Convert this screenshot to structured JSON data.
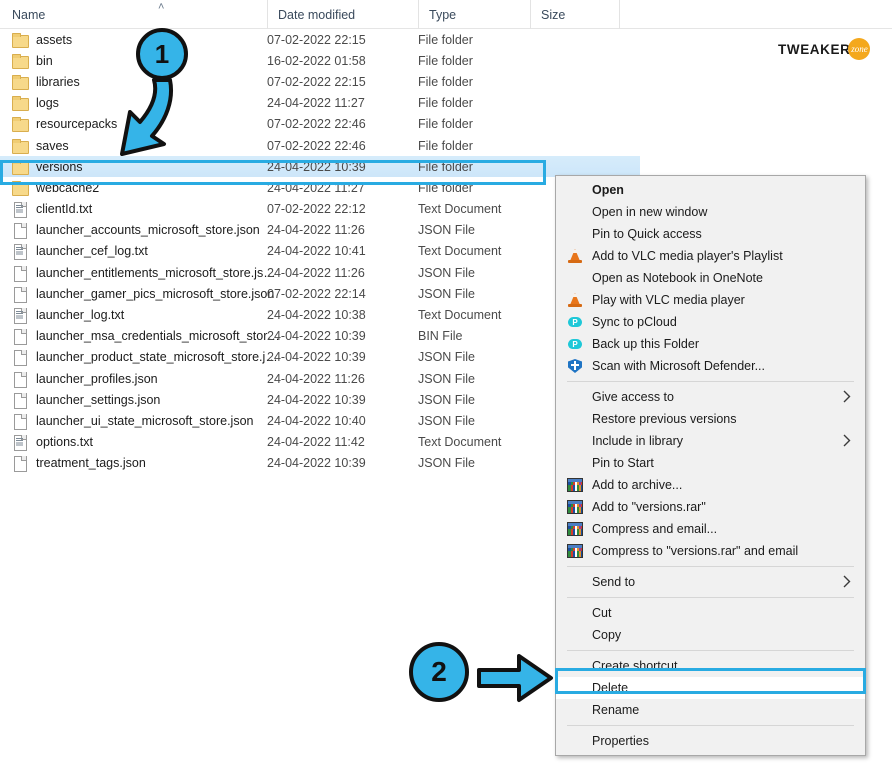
{
  "window": {
    "app": "windows-file-explorer",
    "logo": {
      "text": "TWEAKER",
      "badge": "zone",
      "color": "#F4A81D"
    }
  },
  "columns": [
    {
      "label": "Name",
      "sorted": "ascending",
      "caret": "˄"
    },
    {
      "label": "Date modified"
    },
    {
      "label": "Type"
    },
    {
      "label": "Size"
    }
  ],
  "files": [
    {
      "name": "assets",
      "date": "07-02-2022 22:15",
      "type": "File folder",
      "size": "",
      "icon": "folder",
      "selected": false
    },
    {
      "name": "bin",
      "date": "16-02-2022 01:58",
      "type": "File folder",
      "size": "",
      "icon": "folder",
      "selected": false
    },
    {
      "name": "libraries",
      "date": "07-02-2022 22:15",
      "type": "File folder",
      "size": "",
      "icon": "folder",
      "selected": false
    },
    {
      "name": "logs",
      "date": "24-04-2022 11:27",
      "type": "File folder",
      "size": "",
      "icon": "folder",
      "selected": false
    },
    {
      "name": "resourcepacks",
      "date": "07-02-2022 22:46",
      "type": "File folder",
      "size": "",
      "icon": "folder",
      "selected": false
    },
    {
      "name": "saves",
      "date": "07-02-2022 22:46",
      "type": "File folder",
      "size": "",
      "icon": "folder",
      "selected": false
    },
    {
      "name": "versions",
      "date": "24-04-2022 10:39",
      "type": "File folder",
      "size": "",
      "icon": "folder",
      "selected": true
    },
    {
      "name": "webcache2",
      "date": "24-04-2022 11:27",
      "type": "File folder",
      "size": "",
      "icon": "folder",
      "selected": false
    },
    {
      "name": "clientId.txt",
      "date": "07-02-2022 22:12",
      "type": "Text Document",
      "size": "",
      "icon": "txt",
      "selected": false
    },
    {
      "name": "launcher_accounts_microsoft_store.json",
      "date": "24-04-2022 11:26",
      "type": "JSON File",
      "size": "",
      "icon": "file",
      "selected": false
    },
    {
      "name": "launcher_cef_log.txt",
      "date": "24-04-2022 10:41",
      "type": "Text Document",
      "size": "",
      "icon": "txt",
      "selected": false
    },
    {
      "name": "launcher_entitlements_microsoft_store.js…",
      "date": "24-04-2022 11:26",
      "type": "JSON File",
      "size": "",
      "icon": "file",
      "selected": false
    },
    {
      "name": "launcher_gamer_pics_microsoft_store.json",
      "date": "07-02-2022 22:14",
      "type": "JSON File",
      "size": "",
      "icon": "file",
      "selected": false
    },
    {
      "name": "launcher_log.txt",
      "date": "24-04-2022 10:38",
      "type": "Text Document",
      "size": "",
      "icon": "txt",
      "selected": false
    },
    {
      "name": "launcher_msa_credentials_microsoft_stor…",
      "date": "24-04-2022 10:39",
      "type": "BIN File",
      "size": "",
      "icon": "file",
      "selected": false
    },
    {
      "name": "launcher_product_state_microsoft_store.j…",
      "date": "24-04-2022 10:39",
      "type": "JSON File",
      "size": "",
      "icon": "file",
      "selected": false
    },
    {
      "name": "launcher_profiles.json",
      "date": "24-04-2022 11:26",
      "type": "JSON File",
      "size": "",
      "icon": "file",
      "selected": false
    },
    {
      "name": "launcher_settings.json",
      "date": "24-04-2022 10:39",
      "type": "JSON File",
      "size": "",
      "icon": "file",
      "selected": false
    },
    {
      "name": "launcher_ui_state_microsoft_store.json",
      "date": "24-04-2022 10:40",
      "type": "JSON File",
      "size": "",
      "icon": "file",
      "selected": false
    },
    {
      "name": "options.txt",
      "date": "24-04-2022 11:42",
      "type": "Text Document",
      "size": "",
      "icon": "txt",
      "selected": false
    },
    {
      "name": "treatment_tags.json",
      "date": "24-04-2022 10:39",
      "type": "JSON File",
      "size": "",
      "icon": "file",
      "selected": false
    }
  ],
  "context_menu": {
    "items": [
      {
        "label": "Open",
        "icon": "none",
        "bold": true,
        "submenu": false,
        "type": "item"
      },
      {
        "label": "Open in new window",
        "icon": "none",
        "bold": false,
        "submenu": false,
        "type": "item"
      },
      {
        "label": "Pin to Quick access",
        "icon": "none",
        "bold": false,
        "submenu": false,
        "type": "item"
      },
      {
        "label": "Add to VLC media player's Playlist",
        "icon": "vlc",
        "bold": false,
        "submenu": false,
        "type": "item"
      },
      {
        "label": "Open as Notebook in OneNote",
        "icon": "none",
        "bold": false,
        "submenu": false,
        "type": "item"
      },
      {
        "label": "Play with VLC media player",
        "icon": "vlc",
        "bold": false,
        "submenu": false,
        "type": "item"
      },
      {
        "label": "Sync to pCloud",
        "icon": "pcloud",
        "bold": false,
        "submenu": false,
        "type": "item"
      },
      {
        "label": "Back up this Folder",
        "icon": "pcloud",
        "bold": false,
        "submenu": false,
        "type": "item"
      },
      {
        "label": "Scan with Microsoft Defender...",
        "icon": "shield",
        "bold": false,
        "submenu": false,
        "type": "item"
      },
      {
        "type": "separator"
      },
      {
        "label": "Give access to",
        "icon": "none",
        "bold": false,
        "submenu": true,
        "type": "item"
      },
      {
        "label": "Restore previous versions",
        "icon": "none",
        "bold": false,
        "submenu": false,
        "type": "item"
      },
      {
        "label": "Include in library",
        "icon": "none",
        "bold": false,
        "submenu": true,
        "type": "item"
      },
      {
        "label": "Pin to Start",
        "icon": "none",
        "bold": false,
        "submenu": false,
        "type": "item"
      },
      {
        "label": "Add to archive...",
        "icon": "rar",
        "bold": false,
        "submenu": false,
        "type": "item"
      },
      {
        "label": "Add to \"versions.rar\"",
        "icon": "rar",
        "bold": false,
        "submenu": false,
        "type": "item"
      },
      {
        "label": "Compress and email...",
        "icon": "rar",
        "bold": false,
        "submenu": false,
        "type": "item"
      },
      {
        "label": "Compress to \"versions.rar\" and email",
        "icon": "rar",
        "bold": false,
        "submenu": false,
        "type": "item"
      },
      {
        "type": "separator"
      },
      {
        "label": "Send to",
        "icon": "none",
        "bold": false,
        "submenu": true,
        "type": "item"
      },
      {
        "type": "separator"
      },
      {
        "label": "Cut",
        "icon": "none",
        "bold": false,
        "submenu": false,
        "type": "item"
      },
      {
        "label": "Copy",
        "icon": "none",
        "bold": false,
        "submenu": false,
        "type": "item"
      },
      {
        "type": "separator"
      },
      {
        "label": "Create shortcut",
        "icon": "none",
        "bold": false,
        "submenu": false,
        "type": "item"
      },
      {
        "label": "Delete",
        "icon": "none",
        "bold": false,
        "submenu": false,
        "type": "item",
        "highlighted": true
      },
      {
        "label": "Rename",
        "icon": "none",
        "bold": false,
        "submenu": false,
        "type": "item"
      },
      {
        "type": "separator"
      },
      {
        "label": "Properties",
        "icon": "none",
        "bold": false,
        "submenu": false,
        "type": "item"
      }
    ]
  },
  "annotations": {
    "accent_color": "#35B4E8",
    "badges": [
      {
        "label": "1",
        "points_to": "versions-folder-row"
      },
      {
        "label": "2",
        "points_to": "context-menu-delete"
      }
    ]
  }
}
